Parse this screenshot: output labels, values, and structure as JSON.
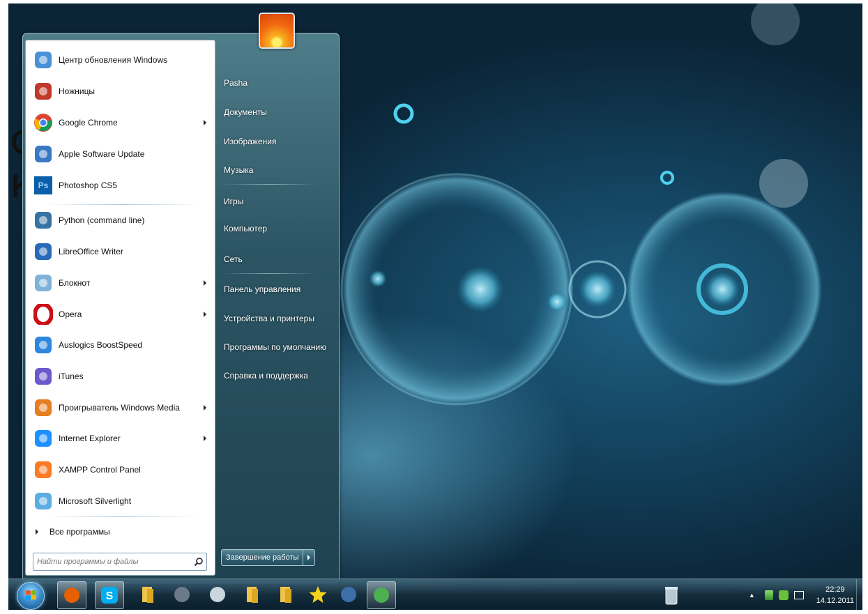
{
  "background_text": {
    "line1": "са",
    "line2": "ко"
  },
  "start_menu": {
    "programs": [
      {
        "label": "Центр обновления Windows",
        "icon": "windows-update-icon",
        "submenu": false
      },
      {
        "label": "Ножницы",
        "icon": "scissors-icon",
        "submenu": false
      },
      {
        "label": "Google Chrome",
        "icon": "chrome-icon",
        "submenu": true
      },
      {
        "label": "Apple Software Update",
        "icon": "apple-update-icon",
        "submenu": false
      },
      {
        "label": "Photoshop CS5",
        "icon": "photoshop-icon",
        "submenu": false
      },
      {
        "label": "Python (command line)",
        "icon": "python-icon",
        "submenu": false
      },
      {
        "label": "LibreOffice Writer",
        "icon": "libreoffice-writer-icon",
        "submenu": false
      },
      {
        "label": "Блокнот",
        "icon": "notepad-icon",
        "submenu": true
      },
      {
        "label": "Opera",
        "icon": "opera-icon",
        "submenu": true
      },
      {
        "label": "Auslogics BoostSpeed",
        "icon": "auslogics-icon",
        "submenu": false
      },
      {
        "label": "iTunes",
        "icon": "itunes-icon",
        "submenu": false
      },
      {
        "label": "Проигрыватель Windows Media",
        "icon": "windows-media-player-icon",
        "submenu": true
      },
      {
        "label": "Internet Explorer",
        "icon": "internet-explorer-icon",
        "submenu": true
      },
      {
        "label": "XAMPP Control Panel",
        "icon": "xampp-icon",
        "submenu": false
      },
      {
        "label": "Microsoft Silverlight",
        "icon": "silverlight-icon",
        "submenu": false
      }
    ],
    "all_programs": "Все программы",
    "search_placeholder": "Найти программы и файлы",
    "right": {
      "user": "Pasha",
      "documents": "Документы",
      "pictures": "Изображения",
      "music": "Музыка",
      "games": "Игры",
      "computer": "Компьютер",
      "network": "Сеть",
      "control_panel": "Панель управления",
      "devices": "Устройства и принтеры",
      "default_programs": "Программы по умолчанию",
      "help": "Справка и поддержка"
    },
    "shutdown": "Завершение работы"
  },
  "taskbar": {
    "pinned": [
      "firefox-icon",
      "skype-icon",
      "folder-icon",
      "video-icon",
      "dvd-icon",
      "folder-icon",
      "folder-icon",
      "star-icon",
      "chess-icon",
      "app-icon"
    ],
    "time": "22:29",
    "date": "14.12.2011"
  },
  "colors": {
    "accent": "#1f4a5c",
    "desktop": "#123f5a"
  }
}
